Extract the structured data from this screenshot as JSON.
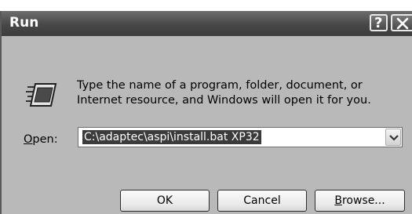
{
  "window": {
    "title": "Run"
  },
  "titlebar": {
    "help_glyph": "?"
  },
  "prompt": {
    "line1": "Type the name of a program, folder, document, or",
    "line2": "Internet resource, and Windows will open it for you."
  },
  "open": {
    "label_accel": "O",
    "label_rest": "pen:",
    "value": "C:\\adaptec\\aspi\\install.bat XP32"
  },
  "buttons": {
    "ok": "OK",
    "cancel": "Cancel",
    "browse_accel": "B",
    "browse_rest": "rowse..."
  },
  "icons": [
    "run-icon",
    "help-icon",
    "close-icon",
    "dropdown-arrow-icon"
  ],
  "colors": {
    "titlebar": "#474747",
    "dialog": "#b9b9b9",
    "selection": "#3b3b3b"
  }
}
